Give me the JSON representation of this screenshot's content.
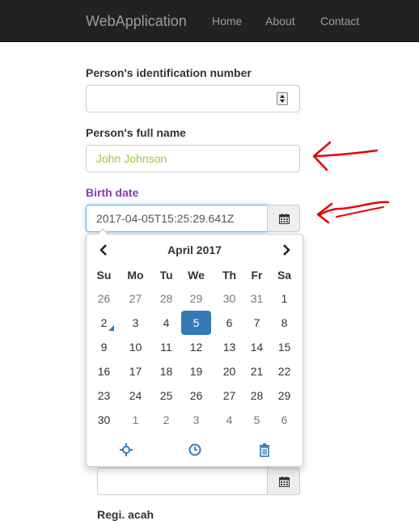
{
  "navbar": {
    "brand": "WebApplication",
    "links": [
      "Home",
      "About",
      "Contact"
    ]
  },
  "form": {
    "id_label": "Person's identification number",
    "id_value": "",
    "name_label": "Person's full name",
    "name_value": "John Johnson",
    "birth_label": "Birth date",
    "birth_value": "2017-04-05T15:25:29.641Z",
    "next_label": "Regi. acah"
  },
  "datepicker": {
    "month_label": "April 2017",
    "weekdays": [
      "Su",
      "Mo",
      "Tu",
      "We",
      "Th",
      "Fr",
      "Sa"
    ],
    "weeks": [
      [
        "26",
        "27",
        "28",
        "29",
        "30",
        "31",
        "1"
      ],
      [
        "2",
        "3",
        "4",
        "5",
        "6",
        "7",
        "8"
      ],
      [
        "9",
        "10",
        "11",
        "12",
        "13",
        "14",
        "15"
      ],
      [
        "16",
        "17",
        "18",
        "19",
        "20",
        "21",
        "22"
      ],
      [
        "23",
        "24",
        "25",
        "26",
        "27",
        "28",
        "29"
      ],
      [
        "30",
        "1",
        "2",
        "3",
        "4",
        "5",
        "6"
      ]
    ],
    "selected_day": "5",
    "today_day": "2",
    "tools": [
      "crosshair-icon",
      "clock-icon",
      "trash-icon"
    ]
  },
  "colors": {
    "navbar_bg": "#222222",
    "navbar_text": "#9d9d9d",
    "valid_green": "#99cc33",
    "label_purple": "#8a3ab9",
    "accent_blue": "#337ab7",
    "focus_border": "#66afe9",
    "annotation_red": "#e60000"
  }
}
